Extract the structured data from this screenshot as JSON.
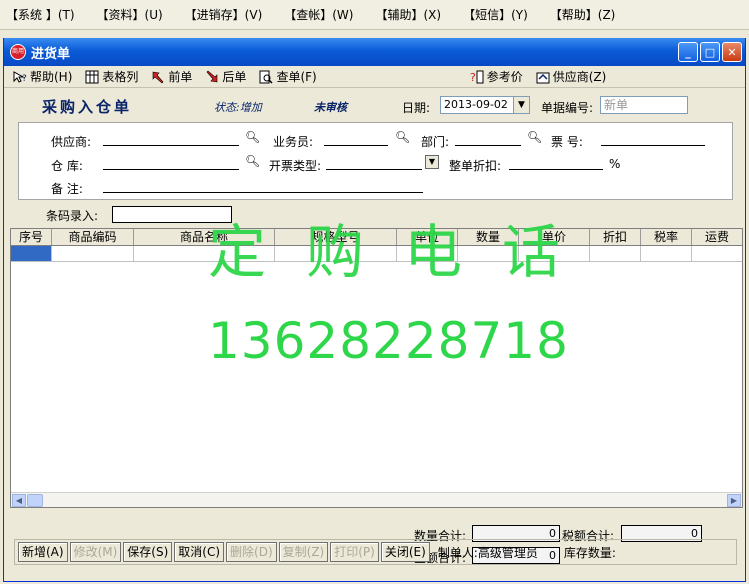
{
  "menubar": {
    "items": [
      "【系统 】(T)",
      "【资料】(U)",
      "【进销存】(V)",
      "【查帐】(W)",
      "【辅助】(X)",
      "【短信】(Y)",
      "【帮助】(Z)"
    ]
  },
  "window": {
    "title": "进货单",
    "icon_text": "商用"
  },
  "toolbar": {
    "help": "帮助(H)",
    "columns": "表格列",
    "prev": "前单",
    "next": "后单",
    "find": "查单(F)",
    "refprice": "参考价",
    "supplier": "供应商(Z)"
  },
  "header": {
    "title": "采购入仓单",
    "status": "状态:增加",
    "audit": "未审核",
    "date_label": "日期:",
    "date_value": "2013-09-02",
    "no_label": "单据编号:",
    "no_value": "新单"
  },
  "form": {
    "supplier_label": "供应商:",
    "salesman_label": "业务员:",
    "dept_label": "部门:",
    "ticket_label": "票  号:",
    "warehouse_label": "仓  库:",
    "invoice_type_label": "开票类型:",
    "discount_label": "整单折扣:",
    "percent": "%",
    "remark_label": "备  注:",
    "barcode_label": "条码录入:"
  },
  "grid": {
    "columns": [
      "序号",
      "商品编码",
      "商品名称",
      "规格型号",
      "单位",
      "数量",
      "单价",
      "折扣",
      "税率",
      "运费"
    ]
  },
  "watermark": {
    "line1": "定购电话",
    "line2": "13628228718"
  },
  "totals": {
    "qty_label": "数量合计:",
    "qty_value": "0",
    "tax_label": "税额合计:",
    "tax_value": "0",
    "amount_label": "金额合计:",
    "amount_value": "0"
  },
  "buttons": {
    "new": "新增(A)",
    "edit": "修改(M)",
    "save": "保存(S)",
    "cancel": "取消(C)",
    "delete": "删除(D)",
    "copy": "复制(Z)",
    "print": "打印(P)",
    "close": "关闭(E)",
    "maker": "制单人:高级管理员",
    "stock": "库存数量:"
  }
}
